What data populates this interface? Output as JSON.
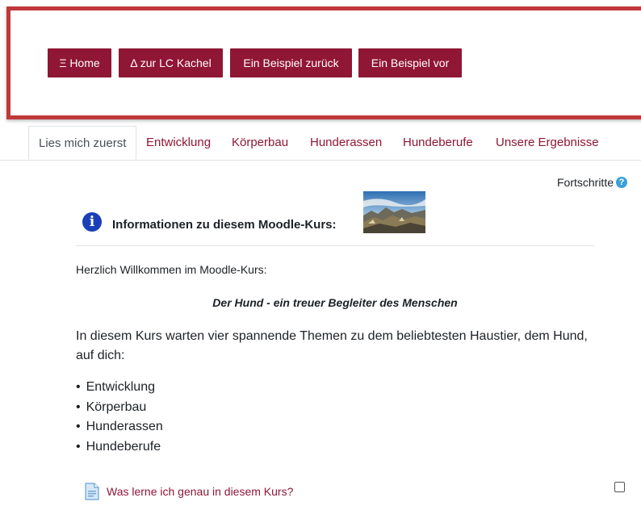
{
  "nav": {
    "home_label": "Ξ Home",
    "tile_label": "Δ zur LC Kachel",
    "prev_label": "Ein Beispiel zurück",
    "next_label": "Ein Beispiel vor"
  },
  "tabs": [
    {
      "label": "Lies mich zuerst",
      "active": true
    },
    {
      "label": "Entwicklung"
    },
    {
      "label": "Körperbau"
    },
    {
      "label": "Hunderassen"
    },
    {
      "label": "Hundeberufe"
    },
    {
      "label": "Unsere Ergebnisse"
    }
  ],
  "progress": {
    "label": "Fortschritte",
    "help_icon": "question-icon"
  },
  "info": {
    "icon": "info-icon",
    "title": "Informationen zu diesem Moodle-Kurs:",
    "image": "landscape-photo"
  },
  "content": {
    "welcome": "Herzlich Willkommen im Moodle-Kurs:",
    "subtitle": "Der Hund - ein treuer Begleiter des Menschen",
    "intro": "In diesem Kurs warten vier spannende Themen zu dem beliebtesten Haustier, dem Hund, auf dich:",
    "topics": [
      "Entwicklung",
      "Körperbau",
      "Hunderassen",
      "Hundeberufe"
    ]
  },
  "activity": {
    "icon": "page-icon",
    "label": "Was lerne ich genau in diesem Kurs?",
    "completed": false
  },
  "colors": {
    "brand": "#8f1634",
    "nav_border": "#c0393b",
    "info_icon": "#1a3fb8",
    "help_icon": "#3aa0d8"
  }
}
